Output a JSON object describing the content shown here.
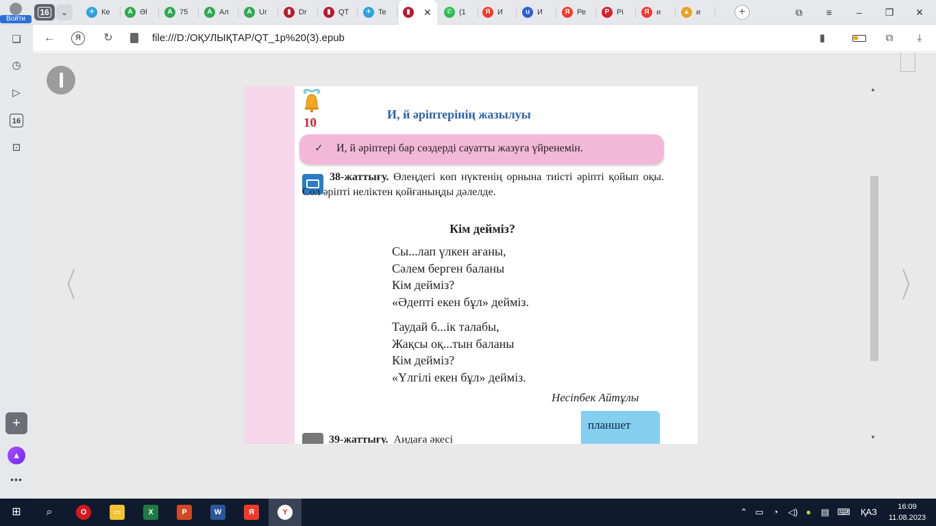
{
  "sidebar_top": {
    "login_label": "Войти"
  },
  "tabs": {
    "count": "16",
    "items": [
      {
        "icon": "telegram-icon",
        "title": "Ке",
        "color": "#2aa3dc",
        "glyph": "✈"
      },
      {
        "icon": "a-icon",
        "title": "Әl",
        "color": "#2fa84f",
        "glyph": "A"
      },
      {
        "icon": "a-icon",
        "title": "75",
        "color": "#2fa84f",
        "glyph": "A"
      },
      {
        "icon": "a-icon",
        "title": "Ал",
        "color": "#2fa84f",
        "glyph": "A"
      },
      {
        "icon": "a-icon",
        "title": "Ur",
        "color": "#2fa84f",
        "glyph": "A"
      },
      {
        "icon": "reader-icon",
        "title": "Dr",
        "color": "#b81c2c",
        "glyph": "▮"
      },
      {
        "icon": "reader-icon",
        "title": "QT",
        "color": "#b81c2c",
        "glyph": "▮"
      },
      {
        "icon": "telegram-icon",
        "title": "Te",
        "color": "#2aa3dc",
        "glyph": "✈"
      },
      {
        "icon": "reader-icon",
        "title": "",
        "color": "#b81c2c",
        "glyph": "▮",
        "active": true
      },
      {
        "icon": "whatsapp-icon",
        "title": "(1",
        "color": "#2bbd4f",
        "glyph": "✆"
      },
      {
        "icon": "yandex-icon",
        "title": "И",
        "color": "#f23a2c",
        "glyph": "Я"
      },
      {
        "icon": "u-icon",
        "title": "И",
        "color": "#2c5fd6",
        "glyph": "u"
      },
      {
        "icon": "yandex-icon",
        "title": "Ре",
        "color": "#f23a2c",
        "glyph": "Я"
      },
      {
        "icon": "pinterest-icon",
        "title": "Pi",
        "color": "#d8202c",
        "glyph": "P"
      },
      {
        "icon": "yandex-icon",
        "title": "и",
        "color": "#f23a2c",
        "glyph": "Я"
      },
      {
        "icon": "image-icon",
        "title": "и",
        "color": "#e8a020",
        "glyph": "▲"
      }
    ]
  },
  "address_bar": {
    "url": "file:///D:/ОҚУЛЫҚТАР/QT_1р%20(3).epub"
  },
  "page": {
    "lesson_number": "10",
    "title": "И, й әріптерінің жазылуы",
    "goal_check": "✓",
    "goal_text": "И, й әріптері бар сөздерді сауатты жазуға үйренемін.",
    "task38_label": "38-жаттығу.",
    "task38_text": "Өлеңдегі көп нүктенің орнына тиісті әріпті қойып оқы. Сол әріпті неліктен қойғаныңды дәлелде.",
    "poem_title": "Кім дейміз?",
    "stanza1": [
      "Сы...лап үлкен ағаны,",
      "Сәлем берген баланы",
      "Кім дейміз?",
      "«Әдепті екен бұл» дейміз."
    ],
    "stanza2": [
      "Таудай б...ік талабы,",
      "Жақсы оқ...тын баланы",
      "Кім дейміз?",
      "«Үлгілі екен бұл» дейміз."
    ],
    "author": "Несіпбек Айтұлы",
    "task39_label": "39-жаттығу.",
    "task39_text": "Аидаға  әкесі",
    "flag_word": "планшет"
  },
  "clock": {
    "time": "16:09",
    "date": "11.08.2023"
  },
  "tray": {
    "lang": "ҚАЗ"
  }
}
